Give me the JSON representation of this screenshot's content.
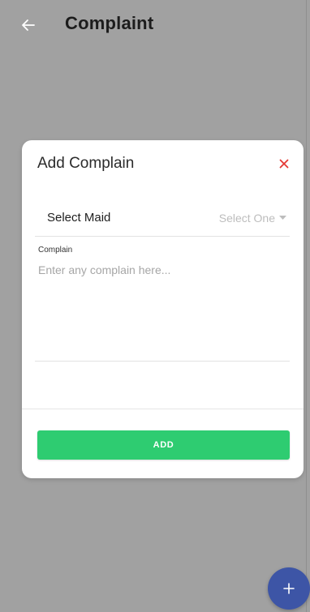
{
  "appbar": {
    "back_icon": "arrow-left-icon",
    "title": "Complaint"
  },
  "dialog": {
    "title": "Add Complain",
    "close_icon": "close-icon",
    "close_color": "#e53935",
    "select": {
      "label": "Select Maid",
      "value": "Select One",
      "caret_icon": "caret-down-icon"
    },
    "complain_field": {
      "label": "Complain",
      "placeholder": "Enter any complain here..."
    },
    "add_button": {
      "label": "ADD",
      "color": "#2ecc71"
    }
  },
  "fab": {
    "icon": "plus-icon",
    "color": "#3d55a6"
  }
}
